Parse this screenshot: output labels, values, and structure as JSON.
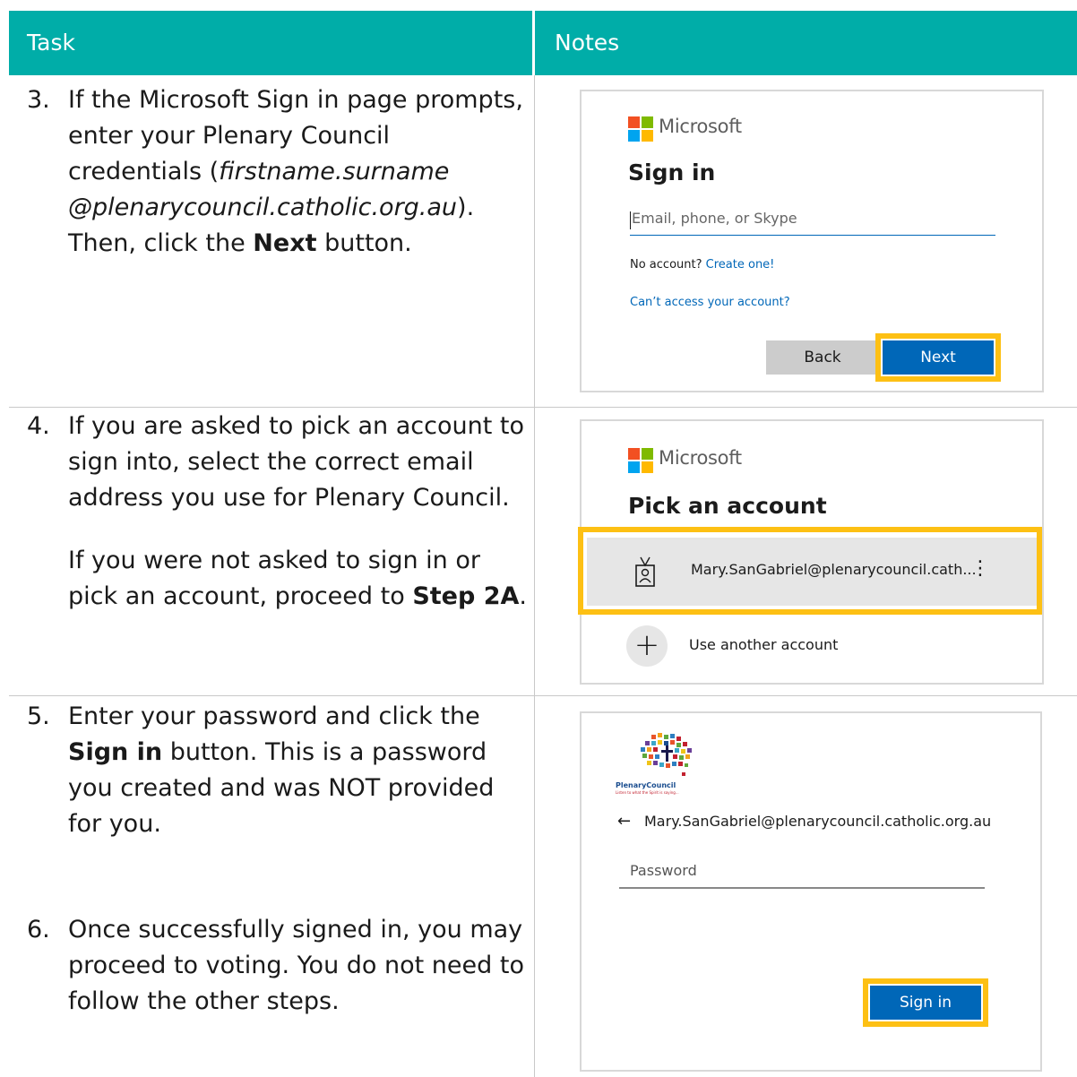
{
  "header": {
    "task_label": "Task",
    "notes_label": "Notes"
  },
  "colors": {
    "header_bg": "#00ada8",
    "highlight": "#fdc014",
    "ms_blue": "#0067b8"
  },
  "steps": [
    {
      "number": "3.",
      "line1": "If the Microsoft Sign in page prompts,",
      "line2": "enter your Plenary Council",
      "line3_pre": "credentials (",
      "line3_italic": "firstname.surname",
      "line4_italic": "@plenarycouncil.catholic.org.au",
      "line4_post": ").",
      "line5_pre": "Then, click the ",
      "line5_bold": "Next",
      "line5_post": " button."
    },
    {
      "number": "4.",
      "line1": "If you are asked to pick an account to",
      "line2": "sign into, select the correct email",
      "line3": "address you use for Plenary Council.",
      "line4": "If you were not asked to sign in or",
      "line5_pre": "pick an account, proceed to ",
      "line5_bold": "Step 2A",
      "line5_post": "."
    },
    {
      "number": "5.",
      "line1": "Enter your password and click the",
      "line2_bold": "Sign in",
      "line2_post": " button.  This is a password",
      "line3": "you created and was NOT provided",
      "line4": "for you."
    },
    {
      "number": "6.",
      "line1": "Once successfully signed in, you may",
      "line2": "proceed to voting. You do not need to",
      "line3": "follow the other steps."
    }
  ],
  "signin_card": {
    "brand": "Microsoft",
    "title": "Sign in",
    "email_placeholder": "Email, phone, or Skype",
    "no_account": "No account?",
    "create_one": "Create one!",
    "cant_access": "Can’t access your account?",
    "back": "Back",
    "next": "Next"
  },
  "pick_card": {
    "brand": "Microsoft",
    "title": "Pick an account",
    "account": "Mary.SanGabriel@plenarycouncil.cath...",
    "more": "⋮",
    "add_icon": "+",
    "use_another": "Use another account"
  },
  "password_card": {
    "logo_text": "PlenaryCouncil",
    "logo_tagline": "Listen to what the Spirit is saying...",
    "back_arrow": "←",
    "email": "Mary.SanGabriel@plenarycouncil.catholic.org.au",
    "password_placeholder": "Password",
    "sign_in": "Sign in"
  }
}
